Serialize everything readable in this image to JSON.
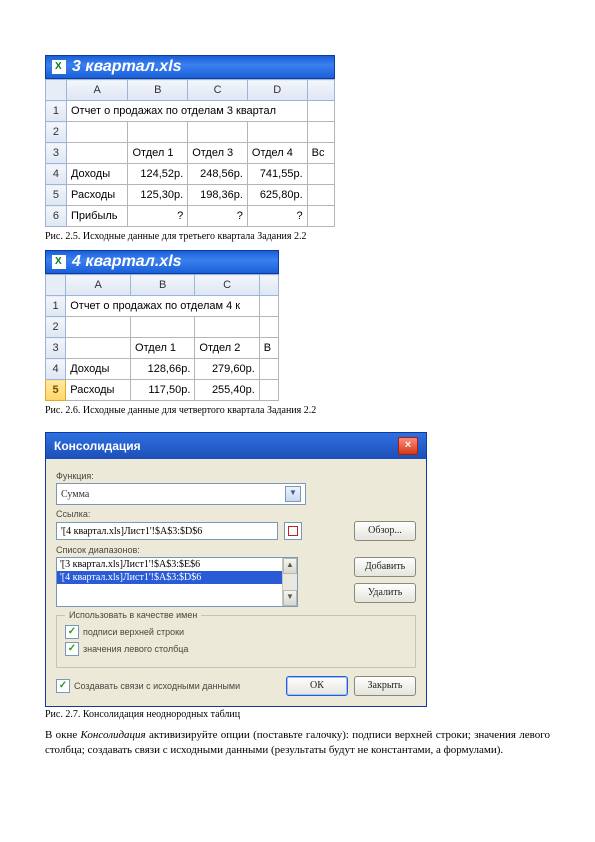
{
  "fig1": {
    "titlebar": "3 квартал.xls",
    "cols": [
      "",
      "A",
      "B",
      "C",
      "D",
      ""
    ],
    "rows": [
      {
        "n": "1",
        "cells": [
          "Отчет о продажах по отделам 3 квартал",
          "",
          "",
          "",
          ""
        ],
        "merge": 4
      },
      {
        "n": "2",
        "cells": [
          "",
          "",
          "",
          "",
          ""
        ]
      },
      {
        "n": "3",
        "cells": [
          "",
          "Отдел 1",
          "Отдел 3",
          "Отдел 4",
          "Вс"
        ]
      },
      {
        "n": "4",
        "cells": [
          "Доходы",
          "124,52р.",
          "248,56р.",
          "741,55р.",
          ""
        ]
      },
      {
        "n": "5",
        "cells": [
          "Расходы",
          "125,30р.",
          "198,36р.",
          "625,80р.",
          ""
        ]
      },
      {
        "n": "6",
        "cells": [
          "Прибыль",
          "?",
          "?",
          "?",
          ""
        ]
      }
    ],
    "caption": "Рис. 2.5. Исходные данные для третьего квартала Задания 2.2"
  },
  "fig2": {
    "titlebar": "4 квартал.xls",
    "cols": [
      "",
      "A",
      "B",
      "C",
      ""
    ],
    "rows": [
      {
        "n": "1",
        "cells": [
          "Отчет о продажах по отделам 4 к",
          "",
          "",
          ""
        ],
        "merge": 3
      },
      {
        "n": "2",
        "cells": [
          "",
          "",
          "",
          ""
        ]
      },
      {
        "n": "3",
        "cells": [
          "",
          "Отдел 1",
          "Отдел 2",
          "В"
        ]
      },
      {
        "n": "4",
        "cells": [
          "Доходы",
          "128,66р.",
          "279,60р.",
          ""
        ]
      },
      {
        "n": "5",
        "cells": [
          "Расходы",
          "117,50р.",
          "255,40р.",
          ""
        ],
        "sel": true
      }
    ],
    "caption": "Рис. 2.6. Исходные данные для четвертого квартала Задания 2.2"
  },
  "dialog": {
    "title": "Консолидация",
    "labels": {
      "function": "Функция:",
      "function_value": "Сумма",
      "reference": "Ссылка:",
      "reference_value": "'[4 квартал.xls]Лист1'!$A$3:$D$6",
      "list": "Список диапазонов:",
      "list_items": [
        "'[3 квартал.xls]Лист1'!$A$3:$E$6",
        "'[4 квартал.xls]Лист1'!$A$3:$D$6"
      ],
      "browse": "Обзор...",
      "add": "Добавить",
      "delete": "Удалить",
      "group": "Использовать в качестве имен",
      "chk1": "подписи верхней строки",
      "chk2": "значения левого столбца",
      "chk3": "Создавать связи с исходными данными",
      "ok": "ОК",
      "close": "Закрыть"
    },
    "caption": "Рис. 2.7. Консолидация неоднородных таблиц"
  },
  "paragraph": {
    "prefix": "В окне ",
    "em": "Консолидация",
    "rest": " активизируйте опции (поставьте галочку): подписи верхней строки; значения левого столбца; создавать связи с исходными данными (результаты будут не константами, а формулами)."
  }
}
